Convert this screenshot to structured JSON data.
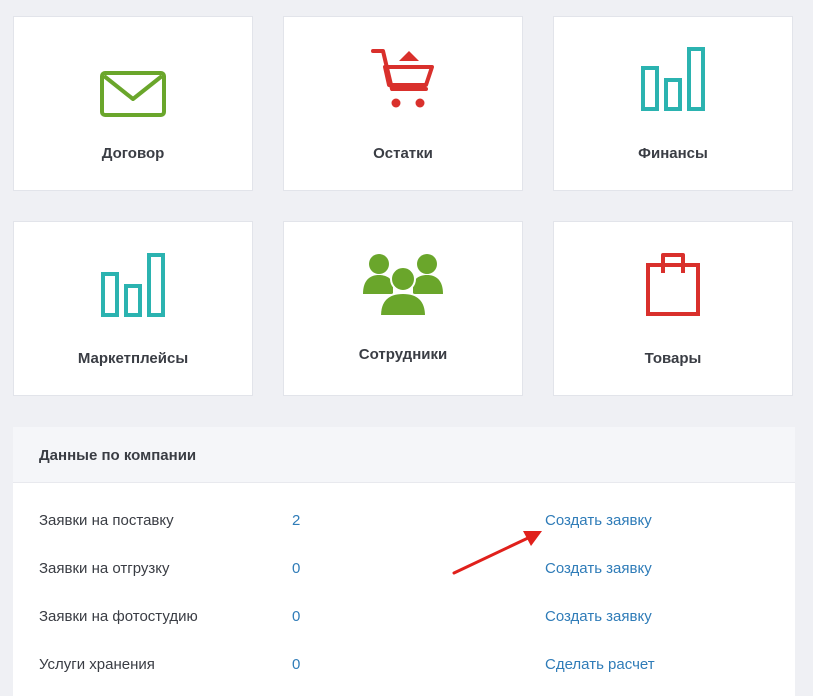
{
  "tiles": [
    {
      "label": "Договор",
      "icon": "envelope-icon",
      "color": "#6aa62b"
    },
    {
      "label": "Остатки",
      "icon": "shopping-cart-icon",
      "color": "#d9302c"
    },
    {
      "label": "Финансы",
      "icon": "bar-chart-icon",
      "color": "#2bb3b0"
    },
    {
      "label": "Маркетплейсы",
      "icon": "bar-chart-icon",
      "color": "#2bb3b0"
    },
    {
      "label": "Сотрудники",
      "icon": "users-group-icon",
      "color": "#6aa62b"
    },
    {
      "label": "Товары",
      "icon": "shopping-bag-icon",
      "color": "#d9302c"
    }
  ],
  "company_panel": {
    "title": "Данные по компании",
    "rows": [
      {
        "label": "Заявки на поставку",
        "count": "2",
        "action": "Создать заявку"
      },
      {
        "label": "Заявки на отгрузку",
        "count": "0",
        "action": "Создать заявку"
      },
      {
        "label": "Заявки на фотостудию",
        "count": "0",
        "action": "Создать заявку"
      },
      {
        "label": "Услуги хранения",
        "count": "0",
        "action": "Сделать расчет"
      }
    ]
  },
  "colors": {
    "link": "#2f7cb8",
    "text": "#3a3d44",
    "background": "#eff0f4",
    "annotation_arrow": "#e0201b"
  }
}
